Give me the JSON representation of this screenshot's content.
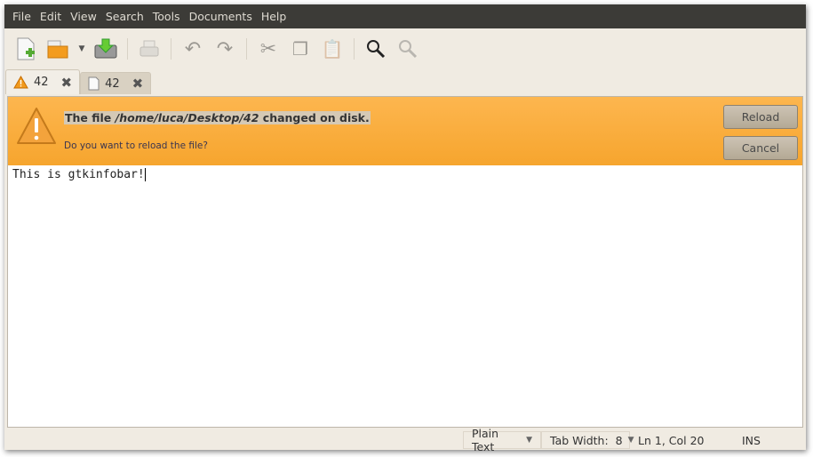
{
  "menu": [
    "File",
    "Edit",
    "View",
    "Search",
    "Tools",
    "Documents",
    "Help"
  ],
  "toolbar": {
    "icons": [
      "new-document",
      "open-folder",
      "open-dropdown",
      "save",
      "print",
      "undo",
      "redo",
      "cut",
      "copy",
      "paste",
      "search",
      "clear-highlight"
    ]
  },
  "tabs": [
    {
      "label": "42",
      "icon": "warning"
    },
    {
      "label": "42",
      "icon": "document"
    }
  ],
  "infobar": {
    "prefix": "The file ",
    "path": "/home/luca/Desktop/42",
    "suffix": " changed on disk.",
    "question": "Do you want to reload the file?",
    "reload": "Reload",
    "cancel": "Cancel",
    "color": "#f8aa35"
  },
  "editor": {
    "content": "This is gtkinfobar!"
  },
  "status": {
    "language": "Plain Text",
    "tab_width": "Tab Width:  8",
    "position": "Ln 1, Col 20",
    "mode": "INS"
  }
}
